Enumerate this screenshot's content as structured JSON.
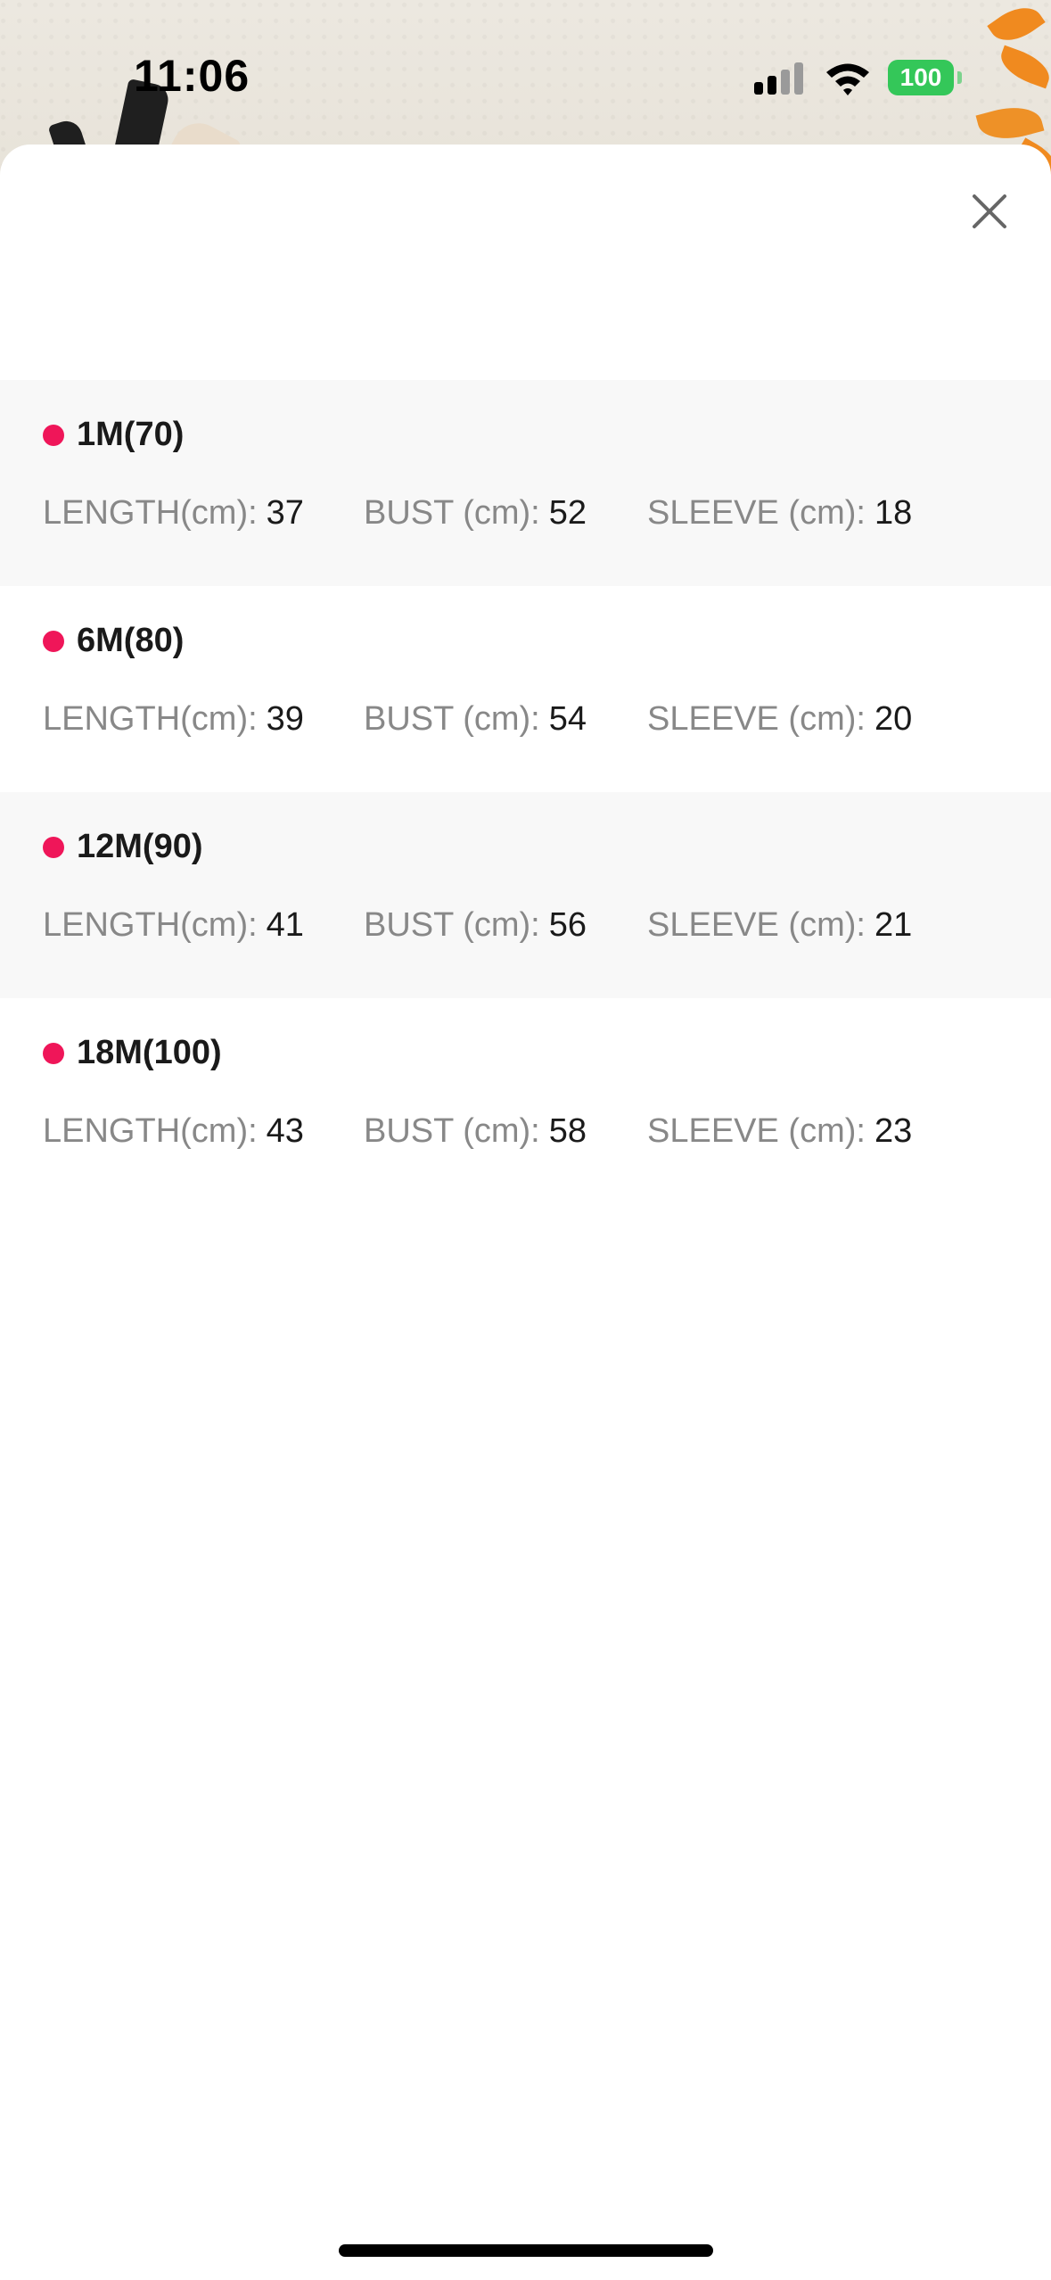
{
  "status_bar": {
    "time": "11:06",
    "battery": "100"
  },
  "colors": {
    "accent_dot": "#ef1659",
    "battery_green": "#34c759",
    "row_shade": "#f8f8f8"
  },
  "sheet": {
    "close_icon": "close-icon"
  },
  "sizes": [
    {
      "name": "1M(70)",
      "length_label": "LENGTH(cm):",
      "length": "37",
      "bust_label": "BUST (cm):",
      "bust": "52",
      "sleeve_label": "SLEEVE (cm):",
      "sleeve": "18"
    },
    {
      "name": "6M(80)",
      "length_label": "LENGTH(cm):",
      "length": "39",
      "bust_label": "BUST (cm):",
      "bust": "54",
      "sleeve_label": "SLEEVE (cm):",
      "sleeve": "20"
    },
    {
      "name": "12M(90)",
      "length_label": "LENGTH(cm):",
      "length": "41",
      "bust_label": "BUST (cm):",
      "bust": "56",
      "sleeve_label": "SLEEVE (cm):",
      "sleeve": "21"
    },
    {
      "name": "18M(100)",
      "length_label": "LENGTH(cm):",
      "length": "43",
      "bust_label": "BUST (cm):",
      "bust": "58",
      "sleeve_label": "SLEEVE (cm):",
      "sleeve": "23"
    }
  ]
}
